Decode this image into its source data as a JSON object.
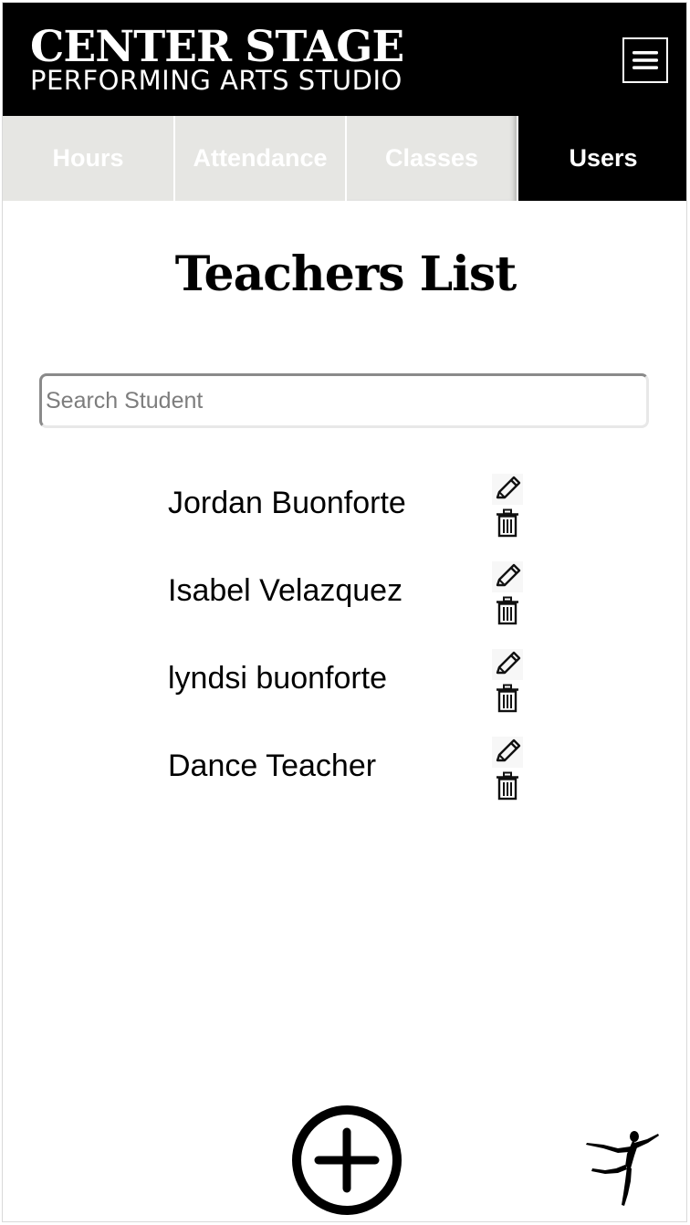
{
  "header": {
    "title": "CENTER STAGE",
    "subtitle": "PERFORMING ARTS STUDIO",
    "menu_icon": "hamburger-menu-icon"
  },
  "tabs": [
    {
      "label": "Hours",
      "active": false
    },
    {
      "label": "Attendance",
      "active": false
    },
    {
      "label": "Classes",
      "active": false
    },
    {
      "label": "Users",
      "active": true
    }
  ],
  "main": {
    "title": "Teachers List",
    "search": {
      "placeholder": "Search Student",
      "value": ""
    },
    "teachers": [
      {
        "name": "Jordan Buonforte"
      },
      {
        "name": "Isabel Velazquez"
      },
      {
        "name": "lyndsi buonforte"
      },
      {
        "name": "Dance Teacher"
      }
    ],
    "row_icons": {
      "edit": "pencil-icon",
      "delete": "trash-icon"
    }
  },
  "footer": {
    "add_icon": "plus-circle-icon",
    "logo_icon": "dancer-silhouette-icon"
  },
  "colors": {
    "header_bg": "#000000",
    "tab_inactive_bg": "#e6e6e3",
    "tab_active_bg": "#000000",
    "text": "#000000"
  }
}
